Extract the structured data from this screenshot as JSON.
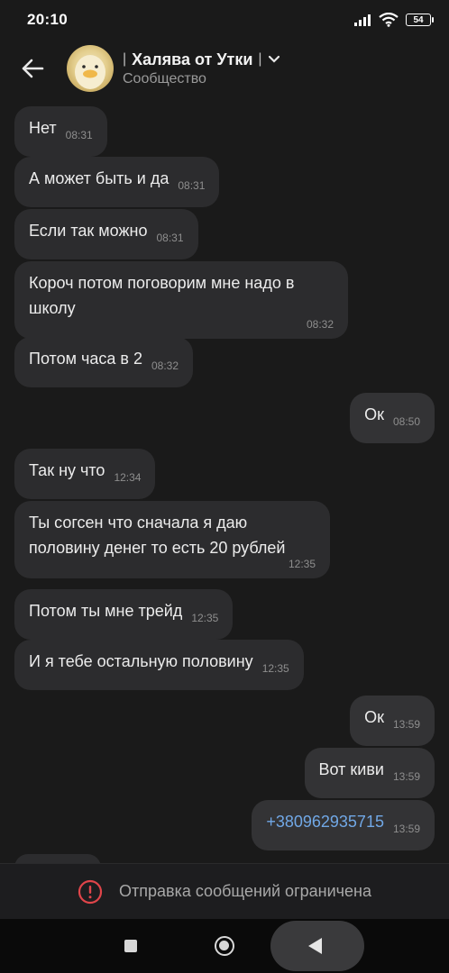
{
  "status_bar": {
    "time": "20:10",
    "battery": "54",
    "icons": [
      "signal-icon",
      "wifi-icon",
      "battery-icon"
    ]
  },
  "header": {
    "title": "Халява от Утки",
    "subtitle": "Сообщество",
    "back_icon": "arrow-left-icon",
    "dropdown_icon": "chevron-down-icon"
  },
  "messages": [
    {
      "direction": "in",
      "text": "Нет",
      "time": "08:31"
    },
    {
      "direction": "in",
      "text": "А может быть и да",
      "time": "08:31"
    },
    {
      "direction": "in",
      "text": "Если так можно",
      "time": "08:31"
    },
    {
      "direction": "in",
      "text": "Короч потом поговорим мне надо в\nшколу",
      "time": "08:32"
    },
    {
      "direction": "in",
      "text": "Потом часа в 2",
      "time": "08:32"
    },
    {
      "direction": "out",
      "text": "Ок",
      "time": "08:50"
    },
    {
      "direction": "in",
      "text": "Так ну что",
      "time": "12:34"
    },
    {
      "direction": "in",
      "text": "Ты согсен что сначала я даю\nполовину денег то есть 20 рублей",
      "time": "12:35"
    },
    {
      "direction": "in",
      "text": "Потом ты мне трейд",
      "time": "12:35"
    },
    {
      "direction": "in",
      "text": "И я тебе остальную половину",
      "time": "12:35"
    },
    {
      "direction": "out",
      "text": "Ок",
      "time": "13:59"
    },
    {
      "direction": "out",
      "text": "Вот киви",
      "time": "13:59"
    },
    {
      "direction": "out",
      "text": "+380962935715",
      "time": "13:59",
      "is_link": true
    }
  ],
  "footer": {
    "restricted_text": "Отправка сообщений ограничена",
    "icon": "warning-circle-icon",
    "accent_color": "#e0454a"
  },
  "nav_bar": {
    "buttons": [
      "recents-square-icon",
      "home-circle-icon",
      "back-triangle-icon"
    ]
  },
  "colors": {
    "background": "#1a1a1a",
    "bubble": "#2c2c2e",
    "link": "#71a8e6"
  }
}
